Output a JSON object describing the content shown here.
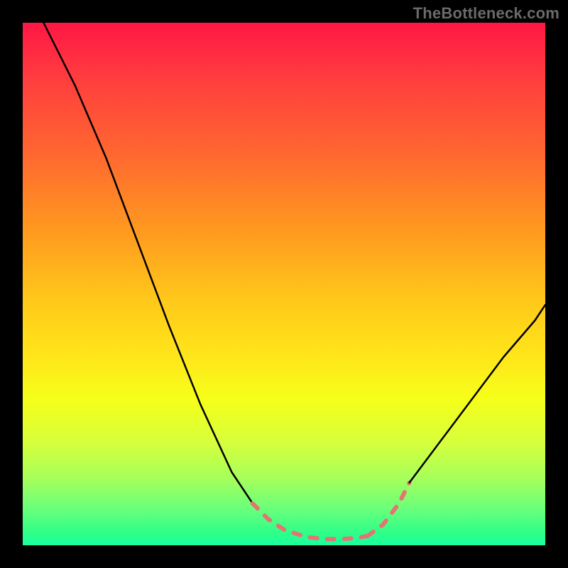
{
  "watermark": "TheBottleneck.com",
  "chart_data": {
    "type": "line",
    "title": "",
    "xlabel": "",
    "ylabel": "",
    "xlim": [
      0,
      100
    ],
    "ylim": [
      0,
      100
    ],
    "grid": false,
    "legend": false,
    "series": [
      {
        "name": "left-curve-black",
        "color": "#000000",
        "width": 2.5,
        "x": [
          4,
          10,
          16,
          22,
          28,
          34,
          40,
          44
        ],
        "values": [
          100,
          88,
          74,
          58,
          42,
          27,
          14,
          8
        ]
      },
      {
        "name": "left-curve-dotted-salmon",
        "color": "#e57373",
        "dotted": true,
        "width": 6,
        "x": [
          44,
          47,
          50,
          53,
          55
        ],
        "values": [
          8,
          5,
          3,
          2,
          1.5
        ]
      },
      {
        "name": "valley-dotted-salmon",
        "color": "#e57373",
        "dotted": true,
        "width": 6,
        "x": [
          55,
          58,
          61,
          64,
          66
        ],
        "values": [
          1.5,
          1.2,
          1.2,
          1.4,
          1.8
        ]
      },
      {
        "name": "right-curve-dotted-salmon",
        "color": "#e57373",
        "dotted": true,
        "width": 6,
        "x": [
          66,
          69,
          72,
          74
        ],
        "values": [
          1.8,
          4,
          8,
          12
        ]
      },
      {
        "name": "right-curve-black",
        "color": "#000000",
        "width": 2.5,
        "x": [
          74,
          80,
          86,
          92,
          98,
          100
        ],
        "values": [
          12,
          20,
          28,
          36,
          43,
          46
        ]
      }
    ]
  }
}
